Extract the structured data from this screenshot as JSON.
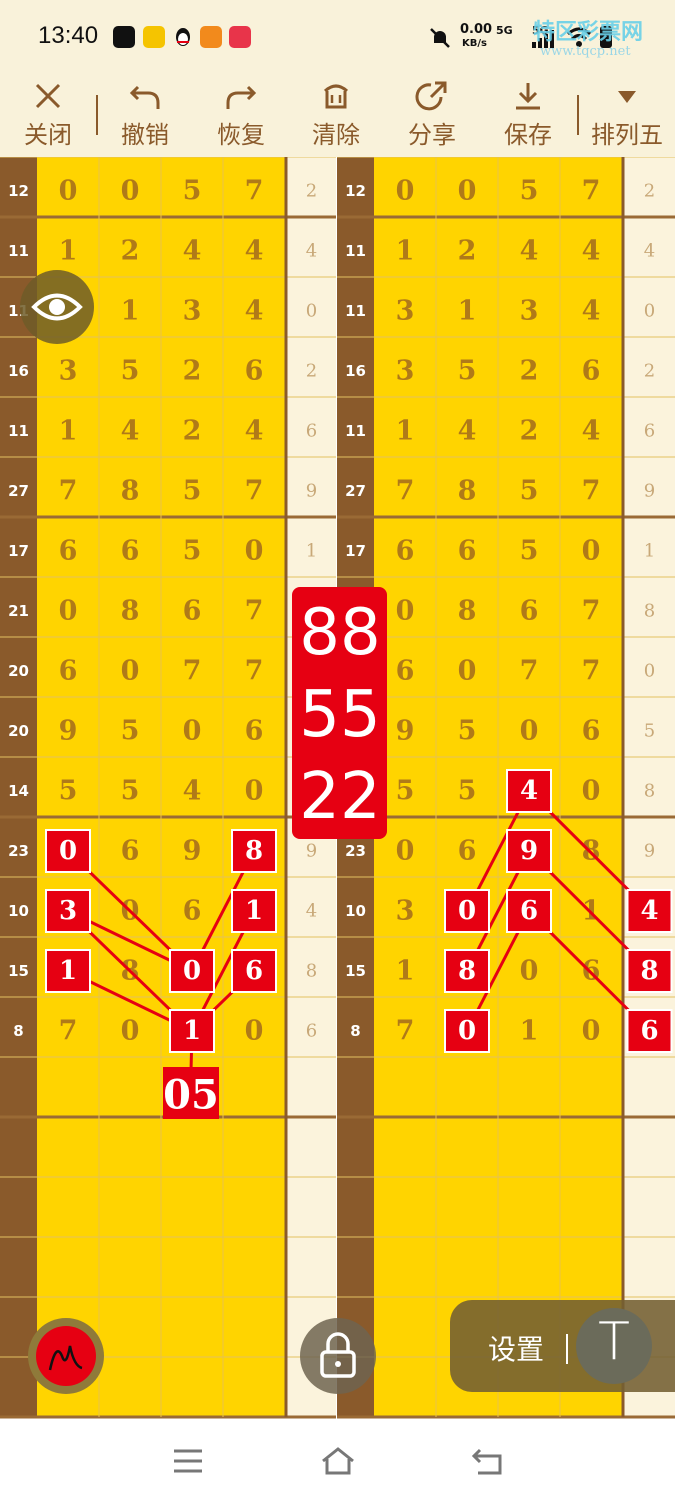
{
  "status_bar": {
    "time": "13:40",
    "net_speed": "0.00",
    "net_unit": "KB/s",
    "network_1": "5G",
    "network_2": "5G",
    "watermark": "特区彩票网",
    "watermark_url": "www.tqcp.net",
    "app_icons": [
      "tiktok-icon",
      "yellow-app-icon",
      "qq-icon",
      "video-app-icon",
      "red-app-icon"
    ]
  },
  "toolbar": {
    "items": [
      {
        "label": "关闭",
        "icon": "close-icon"
      },
      {
        "label": "撤销",
        "icon": "undo-icon"
      },
      {
        "label": "恢复",
        "icon": "redo-icon"
      },
      {
        "label": "清除",
        "icon": "trash-icon"
      },
      {
        "label": "分享",
        "icon": "share-icon"
      },
      {
        "label": "保存",
        "icon": "download-icon"
      },
      {
        "label": "排列五",
        "icon": "triangle-down-icon"
      }
    ]
  },
  "chart": {
    "row_sums": [
      "12",
      "11",
      "11",
      "16",
      "11",
      "27",
      "17",
      "21",
      "20",
      "20",
      "14",
      "23",
      "10",
      "15",
      "8"
    ],
    "digits": [
      [
        "0",
        "0",
        "5",
        "7"
      ],
      [
        "1",
        "2",
        "4",
        "4"
      ],
      [
        "",
        "1",
        "3",
        "4"
      ],
      [
        "3",
        "5",
        "2",
        "6"
      ],
      [
        "1",
        "4",
        "2",
        "4"
      ],
      [
        "7",
        "8",
        "5",
        "7"
      ],
      [
        "6",
        "6",
        "5",
        "0"
      ],
      [
        "0",
        "8",
        "6",
        "7"
      ],
      [
        "6",
        "0",
        "7",
        "7"
      ],
      [
        "9",
        "5",
        "0",
        "6"
      ],
      [
        "5",
        "5",
        "4",
        "0"
      ],
      [
        "0",
        "6",
        "9",
        "8"
      ],
      [
        "3",
        "0",
        "6",
        "1"
      ],
      [
        "1",
        "8",
        "0",
        "6"
      ],
      [
        "7",
        "0",
        "1",
        "0"
      ]
    ],
    "left_digits": [
      [
        "0",
        "0",
        "5",
        "7"
      ],
      [
        "1",
        "2",
        "4",
        "4"
      ],
      [
        "",
        "1",
        "3",
        "4"
      ],
      [
        "3",
        "5",
        "2",
        "6"
      ],
      [
        "1",
        "4",
        "2",
        "4"
      ],
      [
        "7",
        "8",
        "5",
        "7"
      ],
      [
        "6",
        "6",
        "5",
        "0"
      ],
      [
        "0",
        "8",
        "6",
        "7"
      ],
      [
        "6",
        "0",
        "7",
        "7"
      ],
      [
        "9",
        "5",
        "0",
        "6"
      ],
      [
        "5",
        "5",
        "4",
        "0"
      ],
      [
        "",
        "6",
        "9",
        ""
      ],
      [
        "",
        "0",
        "6",
        ""
      ],
      [
        "",
        "8",
        "",
        ""
      ],
      [
        "7",
        "0",
        "",
        "0"
      ]
    ],
    "right_digits": [
      [
        "0",
        "0",
        "5",
        "7"
      ],
      [
        "1",
        "2",
        "4",
        "4"
      ],
      [
        "3",
        "1",
        "3",
        "4"
      ],
      [
        "3",
        "5",
        "2",
        "6"
      ],
      [
        "1",
        "4",
        "2",
        "4"
      ],
      [
        "7",
        "8",
        "5",
        "7"
      ],
      [
        "6",
        "6",
        "5",
        "0"
      ],
      [
        "0",
        "8",
        "6",
        "7"
      ],
      [
        "6",
        "0",
        "7",
        "7"
      ],
      [
        "9",
        "5",
        "0",
        "6"
      ],
      [
        "5",
        "5",
        "",
        "0"
      ],
      [
        "0",
        "6",
        "",
        "8"
      ],
      [
        "3",
        "",
        "",
        "1"
      ],
      [
        "1",
        "",
        "0",
        "6"
      ],
      [
        "7",
        "",
        "1",
        "0"
      ]
    ],
    "fifth_left": [
      "2",
      "4",
      "0",
      "2",
      "6",
      "9",
      "1",
      "",
      "",
      "",
      "",
      "9",
      "4",
      "8",
      "6"
    ],
    "fifth_right": [
      "2",
      "4",
      "0",
      "2",
      "6",
      "9",
      "1",
      "8",
      "0",
      "5",
      "8",
      "9",
      "",
      "",
      ""
    ],
    "left_marks": [
      {
        "row": 11,
        "col": 0,
        "text": "0"
      },
      {
        "row": 12,
        "col": 0,
        "text": "3"
      },
      {
        "row": 13,
        "col": 0,
        "text": "1"
      },
      {
        "row": 11,
        "col": 3,
        "text": "8"
      },
      {
        "row": 12,
        "col": 3,
        "text": "1"
      },
      {
        "row": 13,
        "col": 3,
        "text": "6"
      },
      {
        "row": 13,
        "col": 2,
        "text": "0"
      },
      {
        "row": 14,
        "col": 2,
        "text": "1"
      }
    ],
    "left_result": "05",
    "right_marks": [
      {
        "row": 10,
        "col": 2,
        "text": "4"
      },
      {
        "row": 11,
        "col": 2,
        "text": "9"
      },
      {
        "row": 12,
        "col": 2,
        "text": "6"
      },
      {
        "row": 12,
        "col": 1,
        "text": "0"
      },
      {
        "row": 13,
        "col": 1,
        "text": "8"
      },
      {
        "row": 14,
        "col": 1,
        "text": "0"
      },
      {
        "row": 12,
        "col": 4,
        "text": "4"
      },
      {
        "row": 13,
        "col": 4,
        "text": "8"
      },
      {
        "row": 14,
        "col": 4,
        "text": "6"
      }
    ],
    "center_box": [
      "88",
      "55",
      "22"
    ]
  },
  "floating": {
    "settings_label": "设置",
    "text_tool_label": "T"
  },
  "colors": {
    "yellow": "#ffd400",
    "brown": "#8a5a2b",
    "cream": "#fbf3dc",
    "red": "#e60012"
  }
}
